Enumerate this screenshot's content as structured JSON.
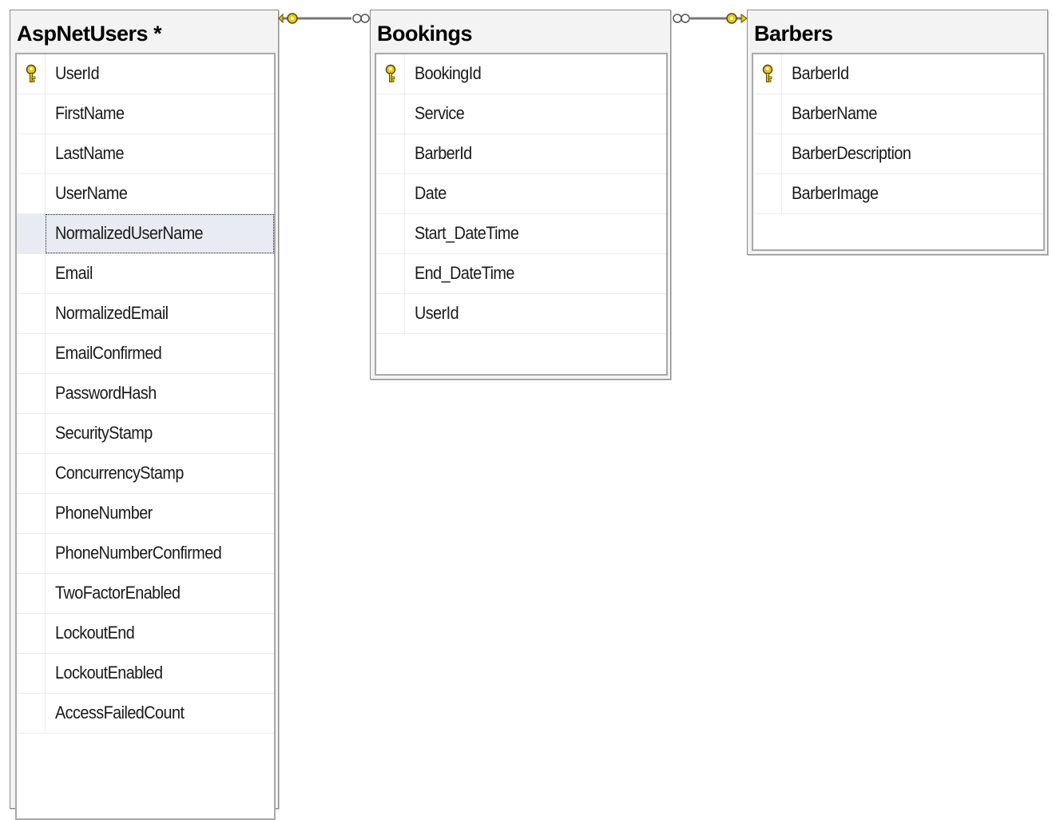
{
  "tables": [
    {
      "id": "aspnetusers",
      "title": "AspNetUsers *",
      "columns": [
        {
          "name": "UserId",
          "primary_key": true,
          "selected": false
        },
        {
          "name": "FirstName",
          "primary_key": false,
          "selected": false
        },
        {
          "name": "LastName",
          "primary_key": false,
          "selected": false
        },
        {
          "name": "UserName",
          "primary_key": false,
          "selected": false
        },
        {
          "name": "NormalizedUserName",
          "primary_key": false,
          "selected": true
        },
        {
          "name": "Email",
          "primary_key": false,
          "selected": false
        },
        {
          "name": "NormalizedEmail",
          "primary_key": false,
          "selected": false
        },
        {
          "name": "EmailConfirmed",
          "primary_key": false,
          "selected": false
        },
        {
          "name": "PasswordHash",
          "primary_key": false,
          "selected": false
        },
        {
          "name": "SecurityStamp",
          "primary_key": false,
          "selected": false
        },
        {
          "name": "ConcurrencyStamp",
          "primary_key": false,
          "selected": false
        },
        {
          "name": "PhoneNumber",
          "primary_key": false,
          "selected": false
        },
        {
          "name": "PhoneNumberConfirmed",
          "primary_key": false,
          "selected": false
        },
        {
          "name": "TwoFactorEnabled",
          "primary_key": false,
          "selected": false
        },
        {
          "name": "LockoutEnd",
          "primary_key": false,
          "selected": false
        },
        {
          "name": "LockoutEnabled",
          "primary_key": false,
          "selected": false
        },
        {
          "name": "AccessFailedCount",
          "primary_key": false,
          "selected": false
        }
      ]
    },
    {
      "id": "bookings",
      "title": "Bookings",
      "columns": [
        {
          "name": "BookingId",
          "primary_key": true,
          "selected": false
        },
        {
          "name": "Service",
          "primary_key": false,
          "selected": false
        },
        {
          "name": "BarberId",
          "primary_key": false,
          "selected": false
        },
        {
          "name": "Date",
          "primary_key": false,
          "selected": false
        },
        {
          "name": "Start_DateTime",
          "primary_key": false,
          "selected": false
        },
        {
          "name": "End_DateTime",
          "primary_key": false,
          "selected": false
        },
        {
          "name": "UserId",
          "primary_key": false,
          "selected": false
        }
      ]
    },
    {
      "id": "barbers",
      "title": "Barbers",
      "columns": [
        {
          "name": "BarberId",
          "primary_key": true,
          "selected": false
        },
        {
          "name": "BarberName",
          "primary_key": false,
          "selected": false
        },
        {
          "name": "BarberDescription",
          "primary_key": false,
          "selected": false
        },
        {
          "name": "BarberImage",
          "primary_key": false,
          "selected": false
        }
      ]
    }
  ],
  "relationships": [
    {
      "from": "aspnetusers",
      "to": "bookings",
      "one_end": "aspnetusers",
      "many_end": "bookings"
    },
    {
      "from": "bookings",
      "to": "barbers",
      "one_end": "barbers",
      "many_end": "bookings"
    }
  ],
  "colors": {
    "key_icon": "#e8c81a",
    "key_outline": "#5a4a00",
    "connector_line": "#777777",
    "selected_row": "#e8ecf2"
  }
}
